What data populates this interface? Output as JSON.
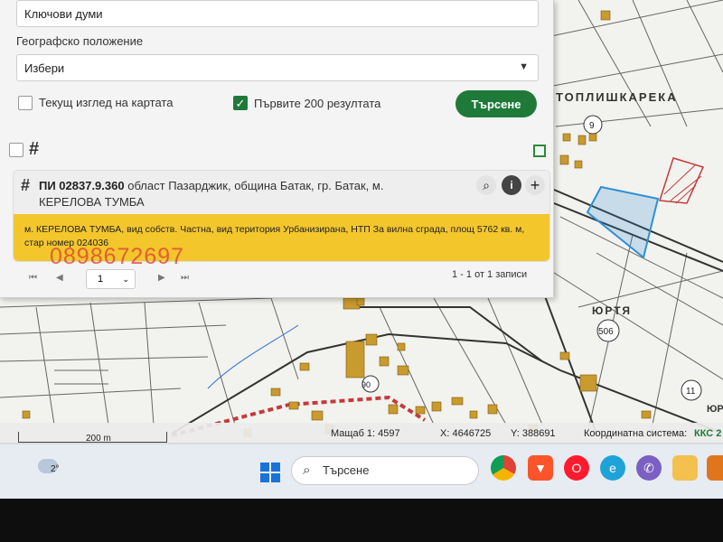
{
  "panel": {
    "keywords_value": "Ключови думи",
    "geo_label": "Географско положение",
    "geo_select_value": "Избери",
    "current_view_label": "Текущ изглед на картата",
    "first200_label": "Първите 200 резултата",
    "search_button": "Търсене"
  },
  "result": {
    "id_text": "ПИ 02837.9.360",
    "title_rest": "област Пазарджик, община Батак, гр. Батак, м.",
    "title_line2": "КЕРЕЛОВА ТУМБА",
    "description": "м. КЕРЕЛОВА ТУМБА, вид собств. Частна, вид територия Урбанизирана, НТП За вилна сграда, площ 5762 кв. м, стар номер 024036",
    "watermark": "0898672697"
  },
  "pager": {
    "page": "1",
    "count_text": "1 - 1 от 1 записи"
  },
  "map_labels": {
    "top_road": "ТОПЛИШКАРЕКА",
    "jurta": "ЮРТЯ",
    "n506": "506",
    "n9": "9",
    "n11": "11",
    "n90": "90",
    "ju": "ЮР"
  },
  "status": {
    "scale_bar": "200 m",
    "scale": "Мащаб 1:  4597",
    "x": "X:  4646725",
    "y": "Y:  388691",
    "crs": "Координатна система:",
    "crs_value": "ККС 2"
  },
  "taskbar": {
    "weather": "2°",
    "search": "Търсене"
  },
  "colors": {
    "accent_green": "#1f7a3a",
    "highlight_yellow": "#f3c62c",
    "selected_parcel": "#2f8fd8"
  }
}
